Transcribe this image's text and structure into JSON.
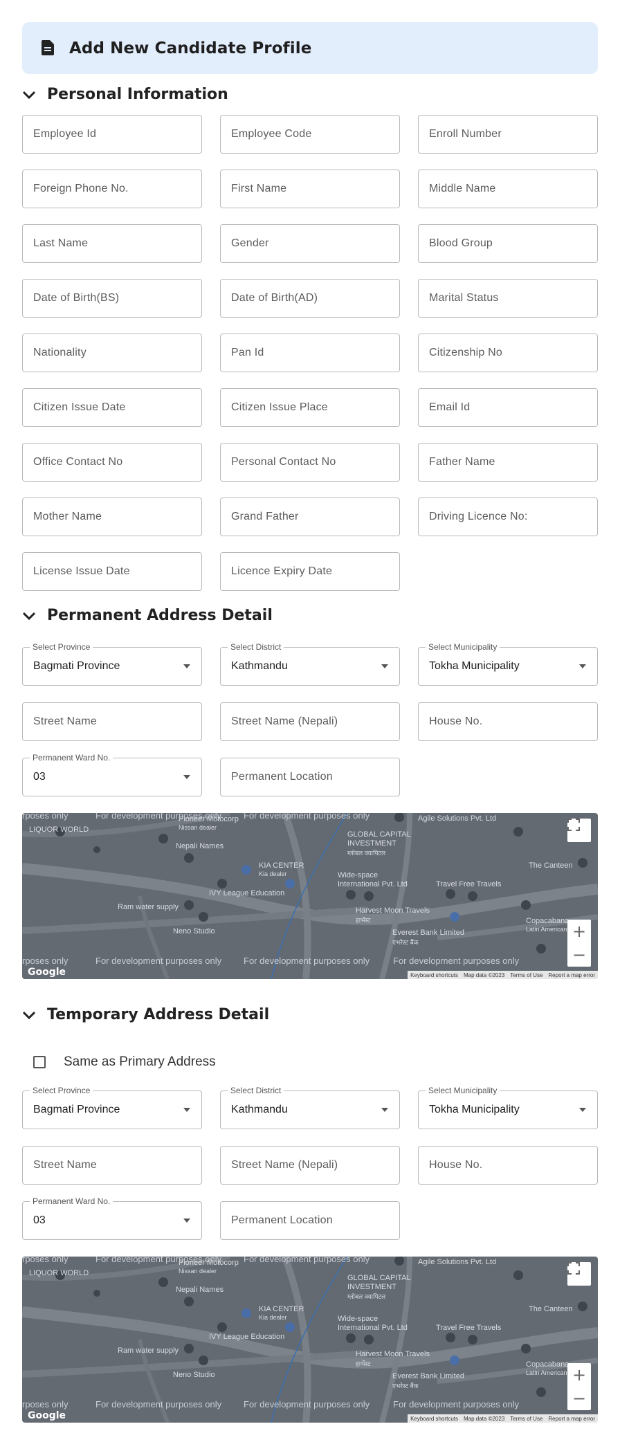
{
  "header": {
    "title": "Add New Candidate Profile",
    "icon": "document-icon"
  },
  "sections": {
    "personal": {
      "title": "Personal Information"
    },
    "permanent": {
      "title": "Permanent Address Detail"
    },
    "temporary": {
      "title": "Temporary Address Detail"
    }
  },
  "personal_fields": [
    "Employee Id",
    "Employee Code",
    "Enroll Number",
    "Foreign Phone No.",
    "First Name",
    "Middle Name",
    "Last Name",
    "Gender",
    "Blood Group",
    "Date of Birth(BS)",
    "Date of Birth(AD)",
    "Marital Status",
    "Nationality",
    "Pan Id",
    "Citizenship No",
    "Citizen Issue Date",
    "Citizen Issue Place",
    "Email Id",
    "Office Contact No",
    "Personal Contact No",
    "Father Name",
    "Mother Name",
    "Grand Father",
    "Driving Licence No:",
    "License Issue Date",
    "Licence Expiry Date"
  ],
  "permanent": {
    "province": {
      "legend": "Select Province",
      "value": "Bagmati Province"
    },
    "district": {
      "legend": "Select District",
      "value": "Kathmandu"
    },
    "municipality": {
      "legend": "Select Municipality",
      "value": "Tokha Municipality"
    },
    "street": "Street Name",
    "street_nepali": "Street Name (Nepali)",
    "house": "House No.",
    "ward": {
      "legend": "Permanent Ward No.",
      "value": "03"
    },
    "location": "Permanent Location"
  },
  "temporary": {
    "same_as_primary": "Same as Primary Address",
    "province": {
      "legend": "Select Province",
      "value": "Bagmati Province"
    },
    "district": {
      "legend": "Select District",
      "value": "Kathmandu"
    },
    "municipality": {
      "legend": "Select Municipality",
      "value": "Tokha Municipality"
    },
    "street": "Street Name",
    "street_nepali": "Street Name (Nepali)",
    "house": "House No.",
    "ward": {
      "legend": "Permanent Ward No.",
      "value": "03"
    },
    "location": "Permanent Location"
  },
  "map": {
    "labels": {
      "liquor": "LIQUOR WORLD",
      "pioneer": "Pioneer Motocorp",
      "nissan": "Nissan dealer",
      "nepali_names": "Nepali Names",
      "kia": "KIA CENTER",
      "kia_sub": "Kia dealer",
      "global": "GLOBAL CAPITAL",
      "investment": "INVESTMENT",
      "global_np": "ग्लोबल क्यापिटल",
      "agile": "Agile Solutions Pvt. Ltd",
      "canteen": "The Canteen",
      "widespace": "Wide-space",
      "widespace2": "International Pvt. Ltd",
      "travel": "Travel Free Travels",
      "harvest": "Harvest Moon Travels",
      "harvest_np": "हार्भेस्ट",
      "ivy": "IVY League Education",
      "ramwater": "Ram water supply",
      "neno": "Neno Studio",
      "everest": "Everest Bank Limited",
      "everest_np": "एभरेस्ट बैंक",
      "copacabana": "Copacabana",
      "copa_sub": "Latin American"
    },
    "dev_text": "For development purposes only",
    "dev_partial_left": "rposes only",
    "dev_top": "rposes only",
    "google": "Google",
    "attrib": [
      "Keyboard shortcuts",
      "Map data ©2023",
      "Terms of Use",
      "Report a map error"
    ],
    "zoom_in": "+",
    "zoom_out": "−"
  }
}
